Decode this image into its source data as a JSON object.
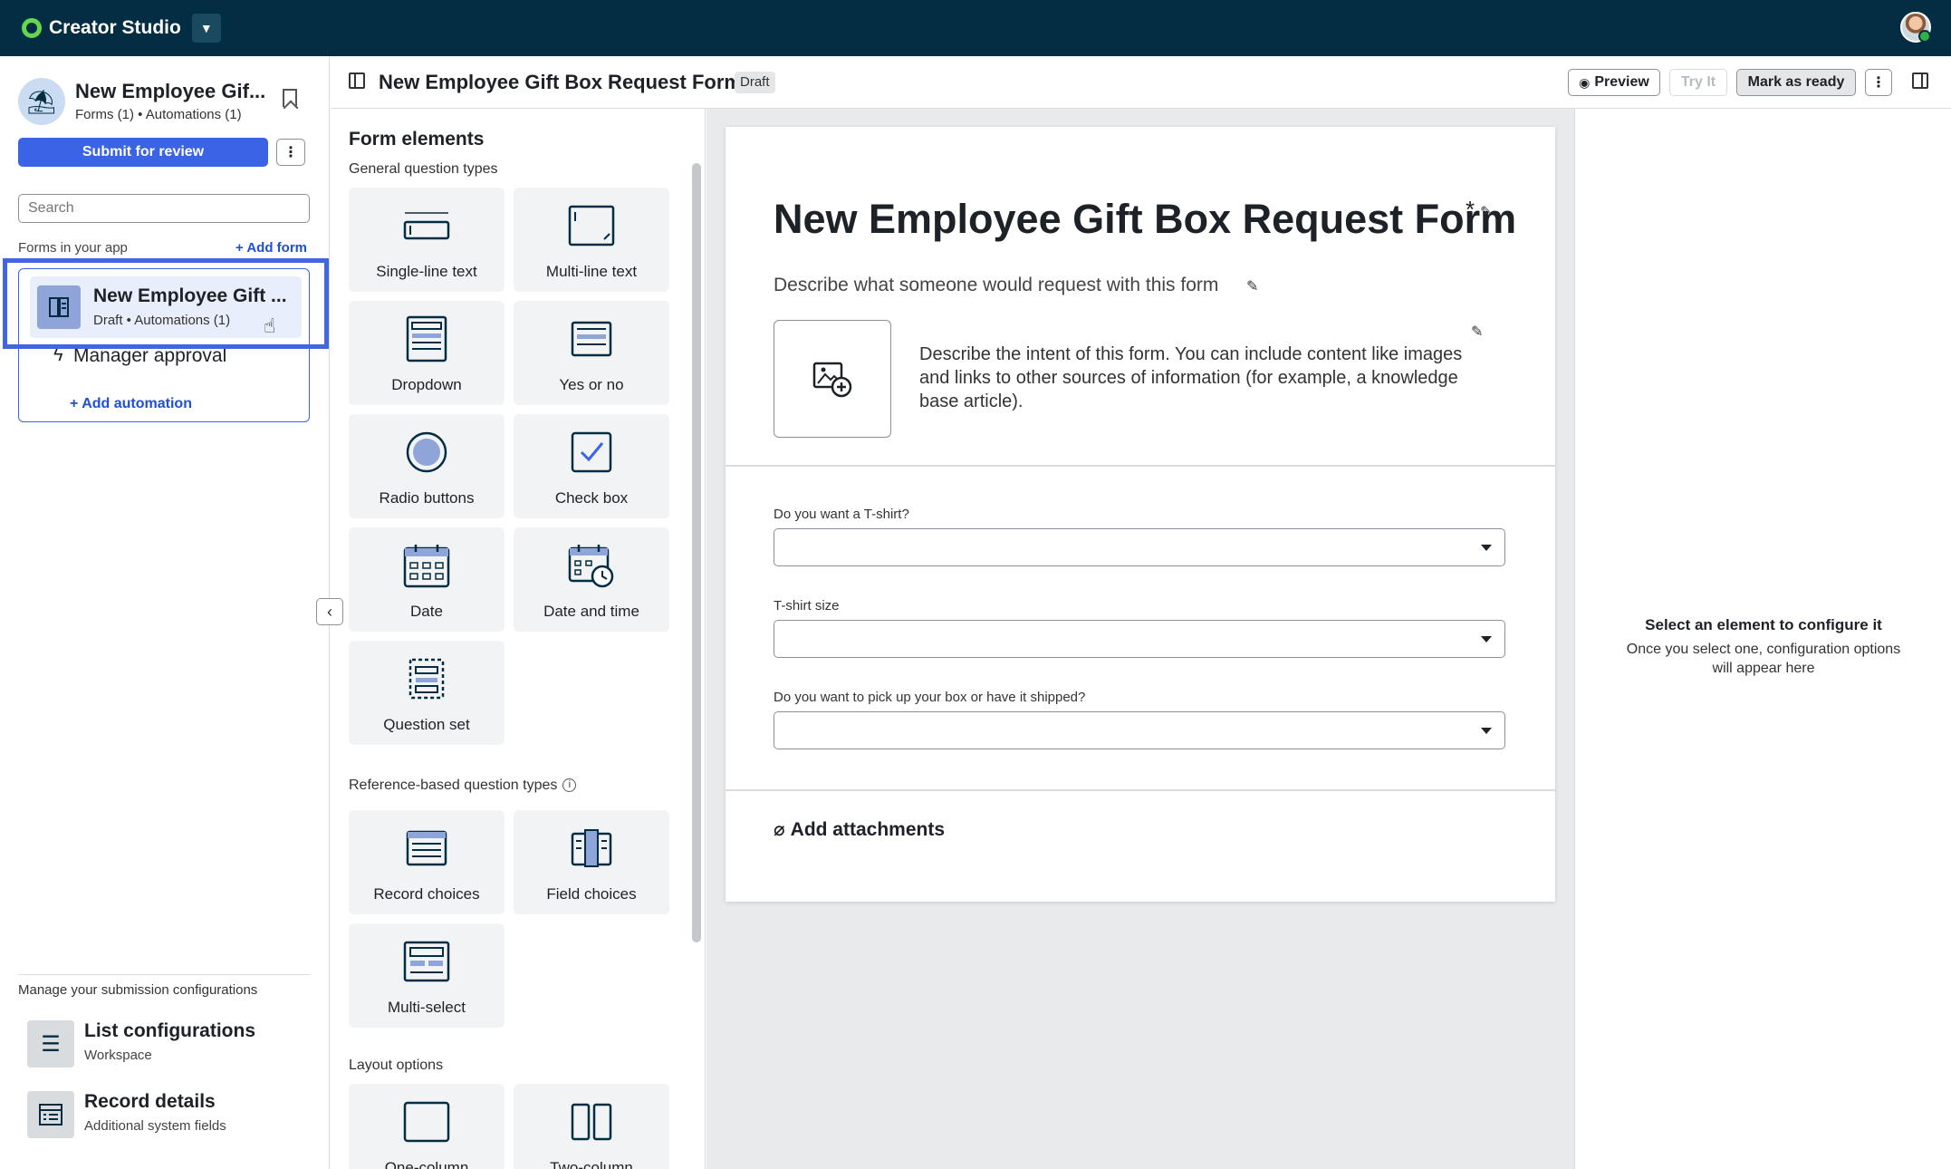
{
  "topbar": {
    "brand": "Creator Studio",
    "brand_color": "#62d84e",
    "bar_color": "#032d42"
  },
  "sidebar": {
    "app_title": "New Employee Gif...",
    "app_sub": "Forms (1) • Automations (1)",
    "submit_label": "Submit for review",
    "more_label": "⋮",
    "search_placeholder": "Search",
    "forms_label": "Forms in your app",
    "add_form_label": "+ Add form",
    "form_item": {
      "title": "New Employee Gift ...",
      "sub": "Draft • Automations (1)"
    },
    "automation": "Manager approval",
    "add_automation_label": "+ Add automation",
    "manage_label": "Manage your submission configurations",
    "configs": [
      {
        "title": "List configurations",
        "sub": "Workspace"
      },
      {
        "title": "Record details",
        "sub": "Additional system fields"
      }
    ]
  },
  "header": {
    "title": "New Employee Gift Box Request Form",
    "badge": "Draft",
    "preview": "Preview",
    "try_it": "Try It",
    "mark_ready": "Mark as ready",
    "more": "⋮"
  },
  "elements": {
    "title": "Form elements",
    "general_label": "General question types",
    "general": [
      {
        "label": "Single-line text",
        "icon": "single-line-text-icon"
      },
      {
        "label": "Multi-line text",
        "icon": "multi-line-text-icon"
      },
      {
        "label": "Dropdown",
        "icon": "dropdown-icon"
      },
      {
        "label": "Yes or no",
        "icon": "yes-no-icon"
      },
      {
        "label": "Radio buttons",
        "icon": "radio-icon"
      },
      {
        "label": "Check box",
        "icon": "checkbox-icon"
      },
      {
        "label": "Date",
        "icon": "calendar-icon"
      },
      {
        "label": "Date and time",
        "icon": "calendar-clock-icon"
      },
      {
        "label": "Question set",
        "icon": "question-set-icon"
      }
    ],
    "reference_label": "Reference-based question types",
    "reference": [
      {
        "label": "Record choices",
        "icon": "record-choices-icon"
      },
      {
        "label": "Field choices",
        "icon": "field-choices-icon"
      },
      {
        "label": "Multi-select",
        "icon": "multi-select-icon"
      }
    ],
    "layout_label": "Layout options",
    "layout": [
      {
        "label": "One-column",
        "icon": "one-column-icon"
      },
      {
        "label": "Two-column",
        "icon": "two-column-icon"
      }
    ]
  },
  "form": {
    "title": "New Employee Gift Box Request Form",
    "required_mark": "*",
    "description": "Describe what someone would request with this form",
    "intent": "Describe the intent of this form. You can include content like images and links to other sources of information (for example, a knowledge base article).",
    "questions": [
      {
        "label": "Do you want a T-shirt?"
      },
      {
        "label": "T-shirt size"
      },
      {
        "label": "Do you want to pick up your box or have it shipped?"
      }
    ],
    "attachments": "Add attachments"
  },
  "config": {
    "title": "Select an element to configure it",
    "desc": "Once you select one, configuration options will appear here"
  }
}
